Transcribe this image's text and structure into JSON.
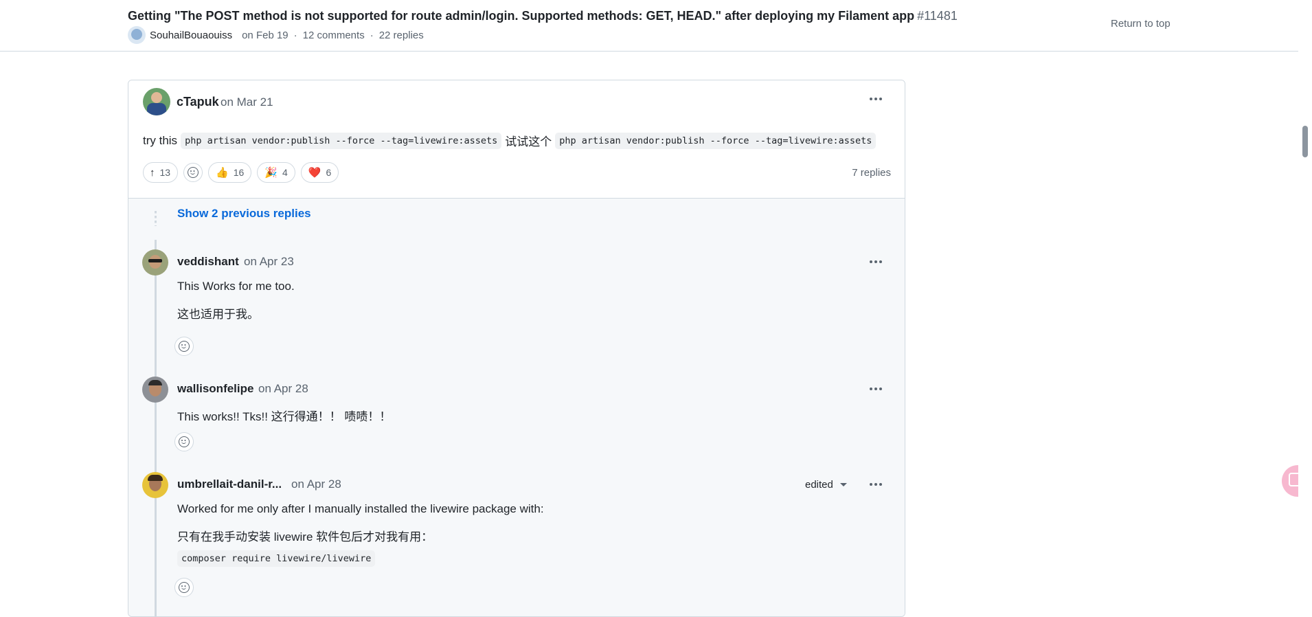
{
  "header": {
    "title": "Getting \"The POST method is not supported for route admin/login. Supported methods: GET, HEAD.\" after deploying my Filament app",
    "number": "#11481",
    "author": "SouhailBouaouiss",
    "date": "on Feb 19",
    "comments": "12 comments",
    "replies": "22 replies",
    "separator": "·",
    "return_to_top": "Return to top"
  },
  "comment": {
    "author": "cTapuk",
    "date": "on Mar 21",
    "body_prefix": "try this",
    "code1": "php artisan vendor:publish --force --tag=livewire:assets",
    "body_middle": "试试这个",
    "code2": "php artisan vendor:publish --force --tag=livewire:assets",
    "upvotes": "13",
    "reactions": [
      {
        "icon": "👍",
        "count": "16"
      },
      {
        "icon": "🎉",
        "count": "4"
      },
      {
        "icon": "❤️",
        "count": "6"
      }
    ],
    "replies_count": "7 replies"
  },
  "thread": {
    "show_previous": "Show 2 previous replies",
    "replies": [
      {
        "author": "veddishant",
        "date": "on Apr 23",
        "lines": [
          "This Works for me too.",
          "这也适用于我。"
        ]
      },
      {
        "author": "wallisonfelipe",
        "date": "on Apr 28",
        "lines": [
          "This works!! Tks!! 这行得通！！ 啧啧！！"
        ]
      },
      {
        "author": "umbrellait-danil-r...",
        "date": "on Apr 28",
        "edited": "edited",
        "lines": [
          "Worked for me only after I manually installed the livewire package with:",
          "只有在我手动安装 livewire 软件包后才对我有用："
        ],
        "code": "composer require livewire/livewire"
      }
    ]
  },
  "icons": {
    "upvote": "arrow-up-icon",
    "reaction_add": "smiley-icon",
    "menu": "kebab-horizontal-icon",
    "translate": "translate-icon"
  },
  "colors": {
    "link": "#0969da",
    "muted": "#59636e",
    "border": "#d1d9e0",
    "reply_bg": "#f6f8fa"
  }
}
